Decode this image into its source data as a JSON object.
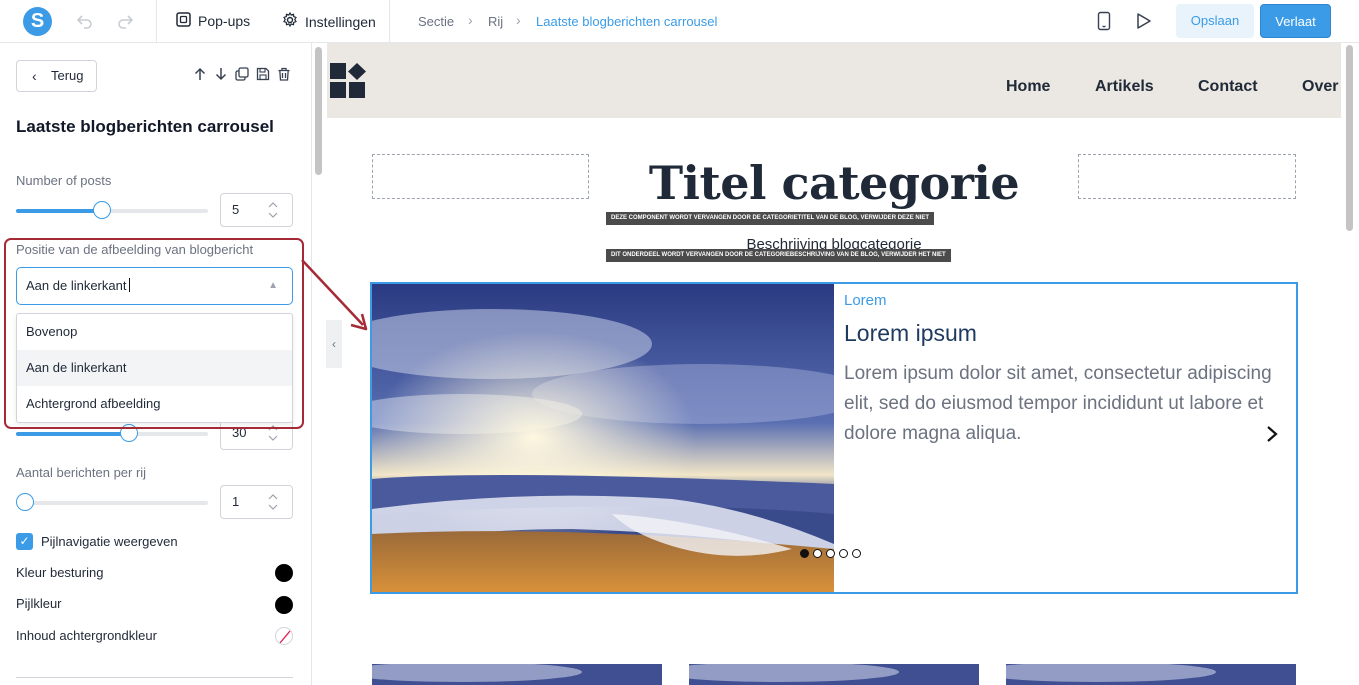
{
  "topbar": {
    "logo_letter": "S",
    "popups_label": "Pop-ups",
    "settings_label": "Instellingen",
    "breadcrumb": [
      "Sectie",
      "Rij",
      "Laatste blogberichten carrousel"
    ],
    "save_label": "Opslaan",
    "leave_label": "Verlaat"
  },
  "panel": {
    "back_label": "Terug",
    "title": "Laatste blogberichten carrousel",
    "number_of_posts": {
      "label": "Number of posts",
      "value": "5",
      "slider_fraction": 0.45
    },
    "image_position": {
      "label": "Positie van de afbeelding van blogbericht",
      "selected": "Aan de linkerkant",
      "options": [
        "Bovenop",
        "Aan de linkerkant",
        "Achtergrond afbeelding"
      ]
    },
    "hidden_slider": {
      "value": "30",
      "slider_fraction": 0.59
    },
    "posts_per_row": {
      "label": "Aantal berichten per rij",
      "value": "1",
      "slider_fraction": 0.0
    },
    "arrow_nav": {
      "label": "Pijlnavigatie weergeven",
      "checked": true
    },
    "control_color": {
      "label": "Kleur besturing",
      "color": "#000000"
    },
    "arrow_color": {
      "label": "Pijlkleur",
      "color": "#000000"
    },
    "content_bg": {
      "label": "Inhoud achtergrondkleur",
      "color": "none"
    }
  },
  "preview": {
    "nav": [
      "Home",
      "Artikels",
      "Contact",
      "Over"
    ],
    "category_title": "Titel categorie",
    "title_tag": "DEZE COMPONENT WORDT VERVANGEN DOOR DE CATEGORIETITEL VAN DE BLOG, VERWIJDER DEZE NIET",
    "category_description": "Beschrijving blogcategorie",
    "desc_tag": "DIT ONDERDEEL WORDT VERVANGEN DOOR DE CATEGORIEBESCHRIJVING VAN DE BLOG, VERWIJDER HET NIET",
    "post": {
      "category": "Lorem",
      "title": "Lorem ipsum",
      "body": "Lorem ipsum dolor sit amet, consectetur adipiscing elit, sed do eiusmod tempor incididunt ut labore et dolore magna aliqua."
    },
    "dots_count": 5,
    "active_dot": 0
  },
  "colors": {
    "accent": "#3b9be6",
    "highlight": "#a52a35"
  }
}
